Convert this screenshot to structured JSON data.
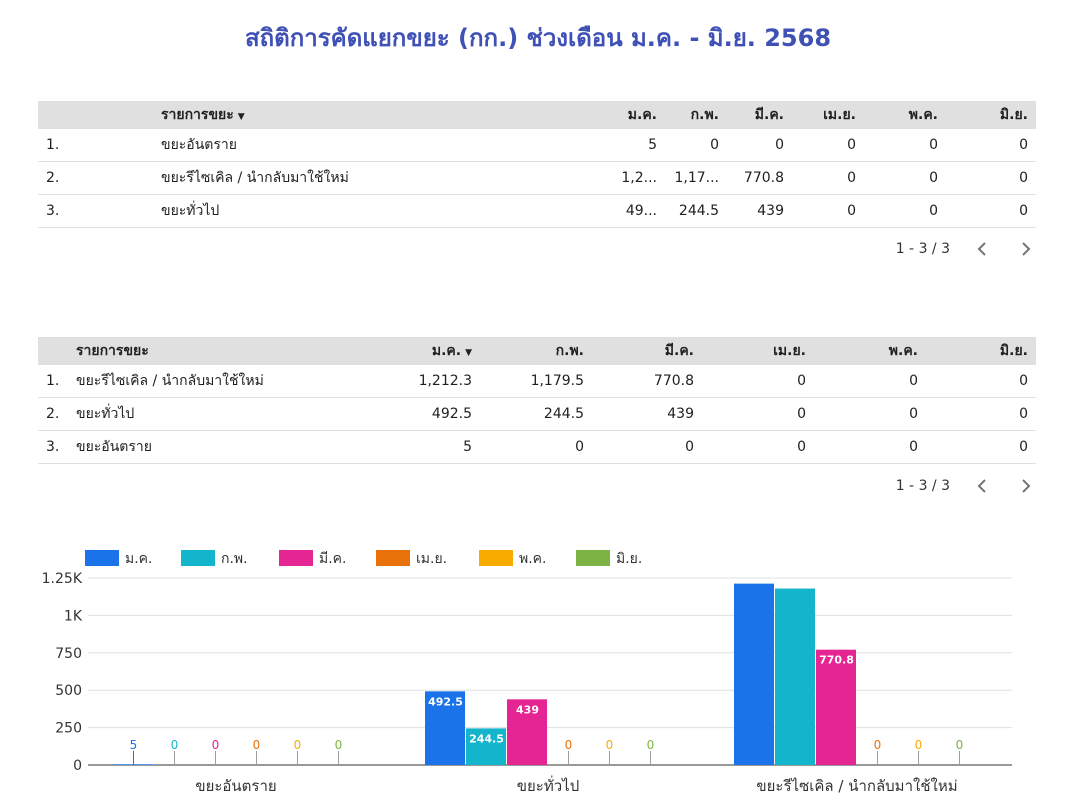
{
  "title": "สถิติการคัดแยกขยะ (กก.) ช่วงเดือน ม.ค. - มิ.ย. 2568",
  "table1": {
    "columns": [
      "รายการขยะ",
      "ม.ค.",
      "ก.พ.",
      "มี.ค.",
      "เม.ย.",
      "พ.ค.",
      "มิ.ย."
    ],
    "sort_indicator": "▼",
    "rows": [
      {
        "index": "1.",
        "name": "ขยะอันตราย",
        "values": [
          "5",
          "0",
          "0",
          "0",
          "0",
          "0"
        ]
      },
      {
        "index": "2.",
        "name": "ขยะรีไซเคิล / นำกลับมาใช้ใหม่",
        "values": [
          "1,2...",
          "1,17...",
          "770.8",
          "0",
          "0",
          "0"
        ]
      },
      {
        "index": "3.",
        "name": "ขยะทั่วไป",
        "values": [
          "49...",
          "244.5",
          "439",
          "0",
          "0",
          "0"
        ]
      }
    ],
    "pagination": "1 - 3 / 3"
  },
  "table2": {
    "columns": [
      "รายการขยะ",
      "ม.ค.",
      "ก.พ.",
      "มี.ค.",
      "เม.ย.",
      "พ.ค.",
      "มิ.ย."
    ],
    "sort_indicator": "▼",
    "rows": [
      {
        "index": "1.",
        "name": "ขยะรีไซเคิล / นำกลับมาใช้ใหม่",
        "values": [
          "1,212.3",
          "1,179.5",
          "770.8",
          "0",
          "0",
          "0"
        ]
      },
      {
        "index": "2.",
        "name": "ขยะทั่วไป",
        "values": [
          "492.5",
          "244.5",
          "439",
          "0",
          "0",
          "0"
        ]
      },
      {
        "index": "3.",
        "name": "ขยะอันตราย",
        "values": [
          "5",
          "0",
          "0",
          "0",
          "0",
          "0"
        ]
      }
    ],
    "pagination": "1 - 3 / 3"
  },
  "chart_data": {
    "type": "bar",
    "categories": [
      "ขยะอันตราย",
      "ขยะทั่วไป",
      "ขยะรีไซเคิล / นำกลับมาใช้ใหม่"
    ],
    "series": [
      {
        "name": "ม.ค.",
        "color": "#1a73e8",
        "values": [
          5,
          492.5,
          1212.3
        ]
      },
      {
        "name": "ก.พ.",
        "color": "#12b5cb",
        "values": [
          0,
          244.5,
          1179.5
        ]
      },
      {
        "name": "มี.ค.",
        "color": "#e52592",
        "values": [
          0,
          439,
          770.8
        ]
      },
      {
        "name": "เม.ย.",
        "color": "#e8710a",
        "values": [
          0,
          0,
          0
        ]
      },
      {
        "name": "พ.ค.",
        "color": "#f9ab00",
        "values": [
          0,
          0,
          0
        ]
      },
      {
        "name": "มิ.ย.",
        "color": "#7cb342",
        "values": [
          0,
          0,
          0
        ]
      }
    ],
    "data_labels": [
      [
        "5",
        "0",
        "0",
        "0",
        "0",
        "0"
      ],
      [
        "492.5",
        "244.5",
        "439",
        "0",
        "0",
        "0"
      ],
      [
        "",
        "",
        "770.8",
        "0",
        "0",
        "0"
      ]
    ],
    "yticks": [
      0,
      250,
      500,
      750,
      1000,
      1250
    ],
    "ytick_labels": [
      "0",
      "250",
      "500",
      "750",
      "1K",
      "1.25K"
    ],
    "ylim": [
      0,
      1250
    ],
    "grid": true,
    "legend_position": "top-left"
  }
}
